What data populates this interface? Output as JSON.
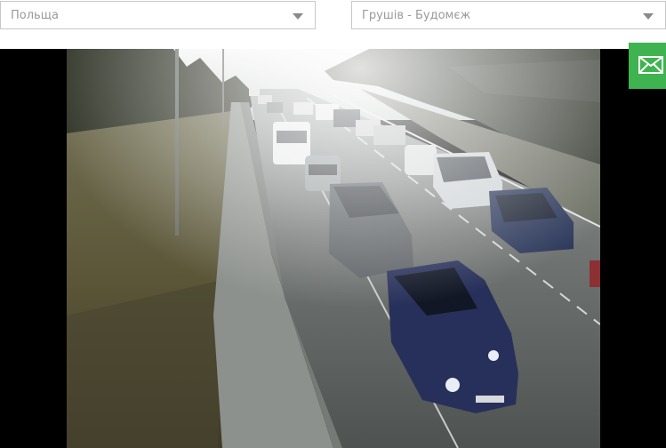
{
  "filters": {
    "country": {
      "value": "Польща",
      "icon": "chevron-down-icon"
    },
    "crossing": {
      "value": "Грушів - Будомєж",
      "icon": "chevron-down-icon"
    }
  },
  "contact": {
    "icon": "envelope-icon",
    "color": "#3fb34f"
  },
  "camera": {
    "description_colors": {
      "road": "#5f6360",
      "grass": "#5a5638",
      "sky": "#e8ecea"
    }
  }
}
